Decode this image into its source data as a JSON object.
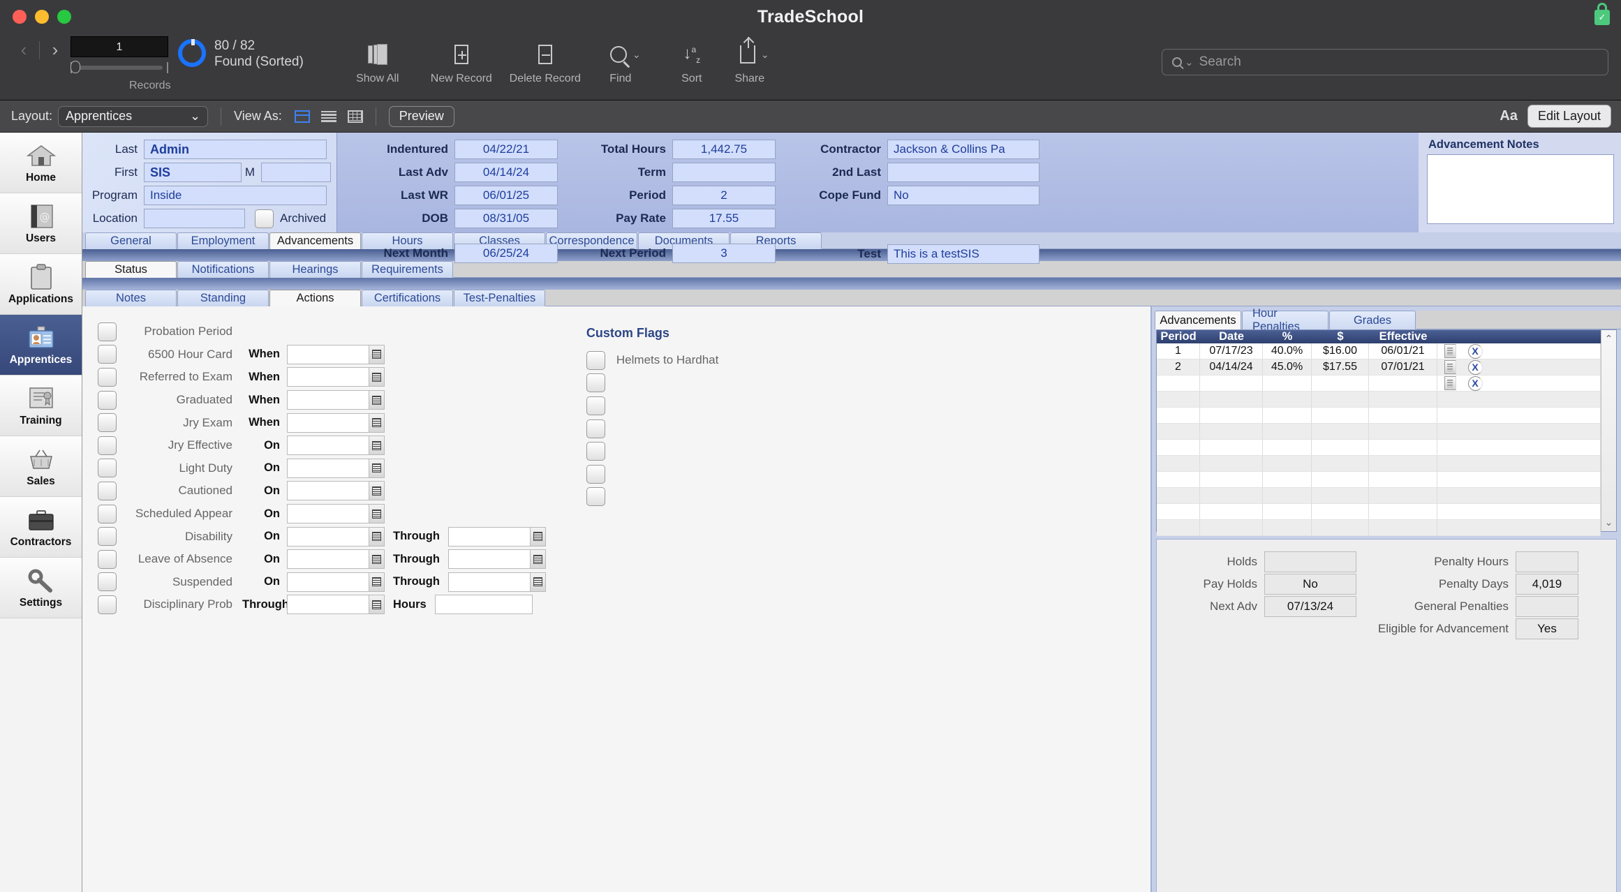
{
  "window": {
    "title": "TradeSchool",
    "lock_icon": "lock-icon"
  },
  "toolbar": {
    "record_number": "1",
    "found_count": "80 / 82",
    "found_status": "Found (Sorted)",
    "records_label": "Records",
    "buttons": [
      {
        "label": "Show All",
        "icon": "copy-records-icon"
      },
      {
        "label": "New Record",
        "icon": "plus-square-icon"
      },
      {
        "label": "Delete Record",
        "icon": "minus-square-icon"
      },
      {
        "label": "Find",
        "icon": "magnifier-icon"
      },
      {
        "label": "Sort",
        "icon": "sort-az-icon"
      },
      {
        "label": "Share",
        "icon": "share-icon"
      }
    ],
    "search_placeholder": "Search"
  },
  "layoutbar": {
    "layout_label": "Layout:",
    "layout_value": "Apprentices",
    "view_as_label": "View As:",
    "view_modes": [
      "form-view-icon",
      "list-view-icon",
      "table-view-icon"
    ],
    "preview_label": "Preview",
    "text_format_label": "Aa",
    "edit_layout_label": "Edit Layout"
  },
  "sidebar": {
    "items": [
      {
        "label": "Home",
        "icon": "house-icon",
        "active": false
      },
      {
        "label": "Users",
        "icon": "address-book-icon",
        "active": false
      },
      {
        "label": "Applications",
        "icon": "clipboard-icon",
        "active": false
      },
      {
        "label": "Apprentices",
        "icon": "id-badge-icon",
        "active": true
      },
      {
        "label": "Training",
        "icon": "certificate-icon",
        "active": false
      },
      {
        "label": "Sales",
        "icon": "basket-icon",
        "active": false
      },
      {
        "label": "Contractors",
        "icon": "briefcase-icon",
        "active": false
      },
      {
        "label": "Settings",
        "icon": "wrench-icon",
        "active": false
      }
    ]
  },
  "header": {
    "left": {
      "last_label": "Last",
      "last_value": "Admin",
      "first_label": "First",
      "first_value": "SIS",
      "middle_label": "M",
      "middle_value": "",
      "program_label": "Program",
      "program_value": "Inside",
      "location_label": "Location",
      "location_value": "",
      "archived_label": "Archived",
      "archived_checked": false
    },
    "mid": {
      "indentured_label": "Indentured",
      "indentured_value": "04/22/21",
      "last_adv_label": "Last Adv",
      "last_adv_value": "04/14/24",
      "last_wr_label": "Last WR",
      "last_wr_value": "06/01/25",
      "dob_label": "DOB",
      "dob_value": "08/31/05",
      "next_month_label": "Next Month",
      "next_month_value": "06/25/24",
      "total_hours_label": "Total Hours",
      "total_hours_value": "1,442.75",
      "term_label": "Term",
      "term_value": "",
      "period_label": "Period",
      "period_value": "2",
      "pay_rate_label": "Pay Rate",
      "pay_rate_value": "17.55",
      "next_period_label": "Next Period",
      "next_period_value": "3",
      "contractor_label": "Contractor",
      "contractor_value": "Jackson & Collins Pa",
      "second_last_label": "2nd Last",
      "second_last_value": "",
      "cope_fund_label": "Cope Fund",
      "cope_fund_value": "No",
      "test_label": "Test",
      "test_value": "This is a testSIS"
    },
    "right": {
      "notes_title": "Advancement Notes",
      "notes_value": ""
    }
  },
  "tabs_level1": [
    {
      "label": "General",
      "active": false
    },
    {
      "label": "Employment",
      "active": false
    },
    {
      "label": "Advancements",
      "active": true
    },
    {
      "label": "Hours",
      "active": false
    },
    {
      "label": "Classes",
      "active": false
    },
    {
      "label": "Correspondence",
      "active": false
    },
    {
      "label": "Documents",
      "active": false
    },
    {
      "label": "Reports",
      "active": false
    }
  ],
  "tabs_level2": [
    {
      "label": "Status",
      "active": true
    },
    {
      "label": "Notifications",
      "active": false
    },
    {
      "label": "Hearings",
      "active": false
    },
    {
      "label": "Requirements",
      "active": false
    }
  ],
  "tabs_level3": [
    {
      "label": "Notes",
      "active": false
    },
    {
      "label": "Standing",
      "active": false
    },
    {
      "label": "Actions",
      "active": true
    },
    {
      "label": "Certifications",
      "active": false
    },
    {
      "label": "Test-Penalties",
      "active": false
    }
  ],
  "actions": [
    {
      "label": "Probation Period",
      "checked": false,
      "prep": "",
      "date": "",
      "has_date": false,
      "second_prep": "",
      "second_value": "",
      "second_type": "none"
    },
    {
      "label": "6500 Hour Card",
      "checked": false,
      "prep": "When",
      "date": "",
      "has_date": true,
      "second_prep": "",
      "second_value": "",
      "second_type": "none"
    },
    {
      "label": "Referred to Exam",
      "checked": false,
      "prep": "When",
      "date": "",
      "has_date": true,
      "second_prep": "",
      "second_value": "",
      "second_type": "none"
    },
    {
      "label": "Graduated",
      "checked": false,
      "prep": "When",
      "date": "",
      "has_date": true,
      "second_prep": "",
      "second_value": "",
      "second_type": "none"
    },
    {
      "label": "Jry Exam",
      "checked": false,
      "prep": "When",
      "date": "",
      "has_date": true,
      "second_prep": "",
      "second_value": "",
      "second_type": "none"
    },
    {
      "label": "Jry Effective",
      "checked": false,
      "prep": "On",
      "date": "",
      "has_date": true,
      "second_prep": "",
      "second_value": "",
      "second_type": "none"
    },
    {
      "label": "Light Duty",
      "checked": false,
      "prep": "On",
      "date": "",
      "has_date": true,
      "second_prep": "",
      "second_value": "",
      "second_type": "none"
    },
    {
      "label": "Cautioned",
      "checked": false,
      "prep": "On",
      "date": "",
      "has_date": true,
      "second_prep": "",
      "second_value": "",
      "second_type": "none"
    },
    {
      "label": "Scheduled Appear",
      "checked": false,
      "prep": "On",
      "date": "",
      "has_date": true,
      "second_prep": "",
      "second_value": "",
      "second_type": "none"
    },
    {
      "label": "Disability",
      "checked": false,
      "prep": "On",
      "date": "",
      "has_date": true,
      "second_prep": "Through",
      "second_value": "",
      "second_type": "date"
    },
    {
      "label": "Leave of Absence",
      "checked": false,
      "prep": "On",
      "date": "",
      "has_date": true,
      "second_prep": "Through",
      "second_value": "",
      "second_type": "date"
    },
    {
      "label": "Suspended",
      "checked": false,
      "prep": "On",
      "date": "",
      "has_date": true,
      "second_prep": "Through",
      "second_value": "",
      "second_type": "date"
    },
    {
      "label": "Disciplinary Prob",
      "checked": false,
      "prep": "Through",
      "date": "",
      "has_date": true,
      "second_prep": "Hours",
      "second_value": "",
      "second_type": "plain"
    }
  ],
  "custom_flags": {
    "title": "Custom Flags",
    "rows": [
      {
        "label": "Helmets to Hardhat",
        "checked": false
      },
      {
        "label": "",
        "checked": false
      },
      {
        "label": "",
        "checked": false
      },
      {
        "label": "",
        "checked": false
      },
      {
        "label": "",
        "checked": false
      },
      {
        "label": "",
        "checked": false
      },
      {
        "label": "",
        "checked": false
      }
    ]
  },
  "right_panel": {
    "tabs": [
      {
        "label": "Advancements",
        "active": true
      },
      {
        "label": "Hour Penalties",
        "active": false
      },
      {
        "label": "Grades",
        "active": false
      }
    ],
    "table": {
      "columns": [
        "Period",
        "Date",
        "%",
        "$",
        "Effective"
      ],
      "rows": [
        {
          "period": "1",
          "date": "07/17/23",
          "pct": "40.0%",
          "amount": "$16.00",
          "effective": "06/01/21"
        },
        {
          "period": "2",
          "date": "04/14/24",
          "pct": "45.0%",
          "amount": "$17.55",
          "effective": "07/01/21"
        },
        {
          "period": "",
          "date": "",
          "pct": "",
          "amount": "",
          "effective": ""
        }
      ],
      "empty_rows": 9,
      "row_doc_icon": "document-icon",
      "row_delete_icon": "delete-x-icon",
      "scroll_up_icon": "chevron-up-icon",
      "scroll_down_icon": "chevron-down-icon"
    },
    "summary_left": [
      {
        "label": "Holds",
        "value": ""
      },
      {
        "label": "Pay Holds",
        "value": "No"
      },
      {
        "label": "Next Adv",
        "value": "07/13/24"
      }
    ],
    "summary_right": [
      {
        "label": "Penalty Hours",
        "value": ""
      },
      {
        "label": "Penalty Days",
        "value": "4,019"
      },
      {
        "label": "General Penalties",
        "value": ""
      }
    ],
    "eligible_label": "Eligible for Advancement",
    "eligible_value": "Yes"
  },
  "colors": {
    "accent_blue": "#1a73ff",
    "tab_text": "#2c4a96",
    "field_text": "#1f3d9c",
    "sidebar_active": "#37487a",
    "grid_header": "#2d3f6e"
  }
}
